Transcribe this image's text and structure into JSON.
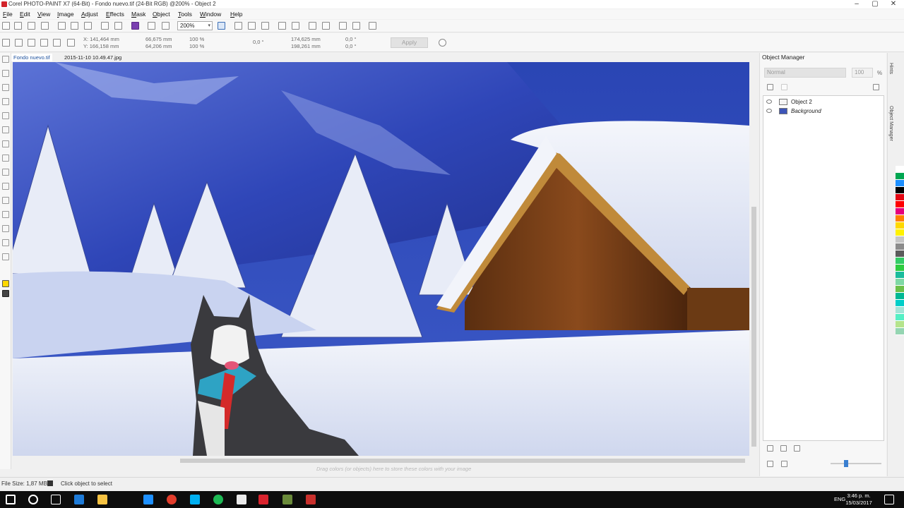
{
  "window": {
    "title": "Corel PHOTO-PAINT X7 (64-Bit) - Fondo nuevo.tif (24-Bit RGB) @200% - Object 2",
    "controls": [
      "minimize",
      "maximize",
      "close"
    ]
  },
  "menu": [
    "File",
    "Edit",
    "View",
    "Image",
    "Adjust",
    "Effects",
    "Mask",
    "Object",
    "Tools",
    "Window",
    "Help"
  ],
  "toolbar": {
    "zoom": "200%"
  },
  "property_bar": {
    "x": "141,464 mm",
    "y": "166,158 mm",
    "width": "66,675 mm",
    "height": "64,206 mm",
    "scale_w": "100 %",
    "scale_h": "100 %",
    "rotation": "0,0 °",
    "center_x": "174,625 mm",
    "center_y": "198,261 mm",
    "skew_h": "0,0 °",
    "skew_v": "0,0 °",
    "apply_label": "Apply"
  },
  "doc_tabs": [
    "Fondo nuevo.tif",
    "2015-11-10 10.49.47.jpg"
  ],
  "color_tray_hint": "Drag colors (or objects) here to store these colors with your image",
  "status": {
    "file_size": "File Size: 1,87 MB",
    "message": "Click object to select"
  },
  "object_manager": {
    "title": "Object Manager",
    "blend_mode": "Normal",
    "opacity": "100",
    "opacity_unit": "%",
    "layers": [
      {
        "name": "Object 2",
        "selected": false
      },
      {
        "name": "Background",
        "selected": false
      }
    ]
  },
  "side_tabs": [
    "Hints",
    "Object Manager"
  ],
  "palette_colors": [
    "#ffffff",
    "#00a651",
    "#1e90ff",
    "#000000",
    "#e30613",
    "#ff0000",
    "#e5007e",
    "#ff7f00",
    "#ffd800",
    "#fff200",
    "#c6c6c6",
    "#8c8c8c",
    "#5b5b5b",
    "#33cc66",
    "#2ecc40",
    "#1abc9c",
    "#7fd8a5",
    "#6cc04a",
    "#00b894",
    "#00cec9",
    "#a3e4d7",
    "#55efc4",
    "#b5e48c",
    "#95d5b2"
  ],
  "taskbar": {
    "language": "ENG",
    "time": "3:46 p. m.",
    "date": "15/03/2017"
  }
}
